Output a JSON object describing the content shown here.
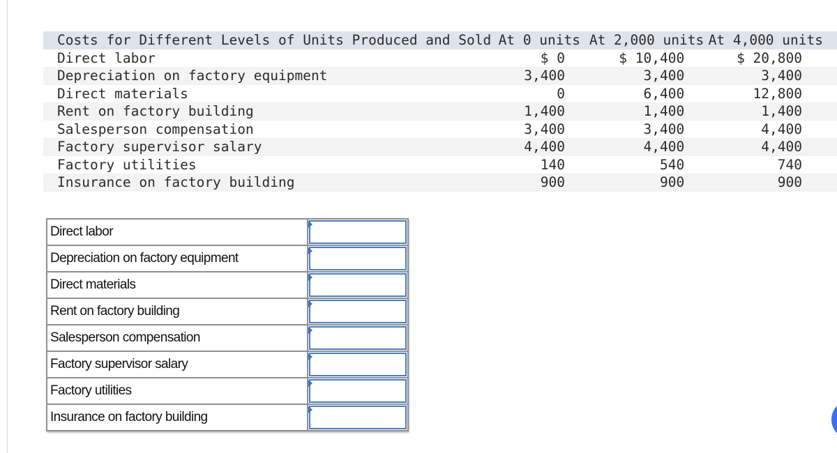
{
  "cost_table": {
    "header": {
      "label": "Costs for Different Levels of Units Produced and Sold",
      "columns": [
        "At 0 units",
        "At 2,000 units",
        "At 4,000 units"
      ]
    },
    "rows": [
      {
        "label": "Direct labor",
        "values": [
          "$ 0",
          "$ 10,400",
          "$ 20,800"
        ]
      },
      {
        "label": "Depreciation on factory equipment",
        "values": [
          "3,400",
          "3,400",
          "3,400"
        ]
      },
      {
        "label": "Direct materials",
        "values": [
          "0",
          "6,400",
          "12,800"
        ]
      },
      {
        "label": "Rent on factory building",
        "values": [
          "1,400",
          "1,400",
          "1,400"
        ]
      },
      {
        "label": "Salesperson compensation",
        "values": [
          "3,400",
          "3,400",
          "4,400"
        ]
      },
      {
        "label": "Factory supervisor salary",
        "values": [
          "4,400",
          "4,400",
          "4,400"
        ]
      },
      {
        "label": "Factory utilities",
        "values": [
          "140",
          "540",
          "740"
        ]
      },
      {
        "label": "Insurance on factory building",
        "values": [
          "900",
          "900",
          "900"
        ]
      }
    ]
  },
  "answer_table": {
    "rows": [
      {
        "label": "Direct labor",
        "selected": ""
      },
      {
        "label": "Depreciation on factory equipment",
        "selected": ""
      },
      {
        "label": "Direct materials",
        "selected": ""
      },
      {
        "label": "Rent on factory building",
        "selected": ""
      },
      {
        "label": "Salesperson compensation",
        "selected": ""
      },
      {
        "label": "Factory supervisor salary",
        "selected": ""
      },
      {
        "label": "Factory utilities",
        "selected": ""
      },
      {
        "label": "Insurance on factory building",
        "selected": ""
      }
    ]
  },
  "colors": {
    "header_bg": "#dfe3ec",
    "stripe_bg": "#f3f3f3",
    "dropdown_border": "#4a7fc1",
    "fab": "#3b6ff0"
  },
  "icons": {
    "dropdown_marker": "triangle-right-icon",
    "help_button": "help-circle-icon"
  }
}
